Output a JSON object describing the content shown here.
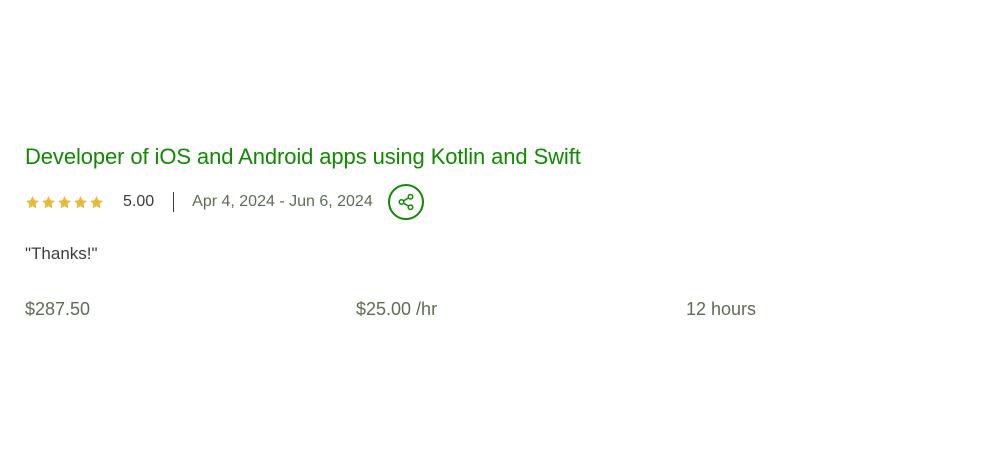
{
  "job": {
    "title": "Developer of iOS and Android apps using Kotlin and Swift",
    "rating": {
      "stars": 5,
      "max_stars": 5,
      "value": "5.00",
      "star_color": "#e7b83a"
    },
    "date_range": "Apr 4, 2024 - Jun 6, 2024",
    "share_icon": "share-icon",
    "feedback": "\"Thanks!\"",
    "stats": {
      "total_earned": "$287.50",
      "hourly_rate": "$25.00 /hr",
      "hours": "12 hours"
    }
  },
  "colors": {
    "accent": "#108a00",
    "text": "#3d3d3d",
    "muted": "#5e6d55"
  }
}
